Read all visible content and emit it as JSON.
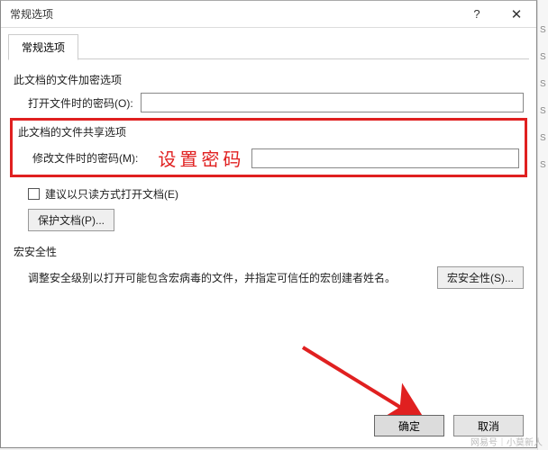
{
  "titlebar": {
    "title": "常规选项",
    "help": "?",
    "close": "✕"
  },
  "tab": {
    "label": "常规选项"
  },
  "encrypt": {
    "section": "此文档的文件加密选项",
    "open_pwd_label": "打开文件时的密码(O):",
    "open_pwd_value": ""
  },
  "share": {
    "section": "此文档的文件共享选项",
    "modify_pwd_label": "修改文件时的密码(M):",
    "modify_pwd_value": "",
    "annotation": "设置密码",
    "readonly_label": "建议以只读方式打开文档(E)",
    "protect_btn": "保护文档(P)..."
  },
  "macro": {
    "section": "宏安全性",
    "desc": "调整安全级别以打开可能包含宏病毒的文件，并指定可信任的宏创建者姓名。",
    "btn": "宏安全性(S)..."
  },
  "footer": {
    "ok": "确定",
    "cancel": "取消"
  },
  "watermark": "网易号｜小莫新人"
}
